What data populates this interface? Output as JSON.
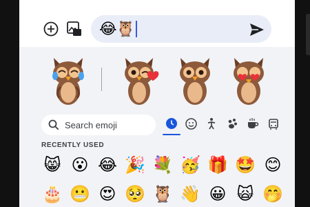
{
  "compose": {
    "message_text": "😂🦉",
    "icons": [
      "add-icon",
      "media-icon",
      "send-icon"
    ]
  },
  "stickers": {
    "items": [
      "owl-laughing-sticker",
      "owl-winking-heart-sticker",
      "owl-neutral-sticker",
      "owl-heart-eyes-sticker"
    ]
  },
  "search": {
    "placeholder": "Search emoji"
  },
  "categories": [
    "recent-icon",
    "smiley-icon",
    "person-icon",
    "animal-icon",
    "food-icon",
    "travel-icon"
  ],
  "recently_used": {
    "title": "RECENTLY USED",
    "rows": [
      [
        "😸",
        "😮",
        "😂",
        "🎉",
        "💐",
        "🥳",
        "🎁",
        "🤩",
        "😊"
      ],
      [
        "🎂",
        "😬",
        "😍",
        "🥺",
        "🦉",
        "👋",
        "😀",
        "🙀",
        "🤭"
      ]
    ]
  },
  "colors": {
    "accent": "#1a56db",
    "compose_bg": "#e9edf7",
    "owl_brown": "#8d5a3b",
    "owl_belly": "#e9b98c"
  }
}
